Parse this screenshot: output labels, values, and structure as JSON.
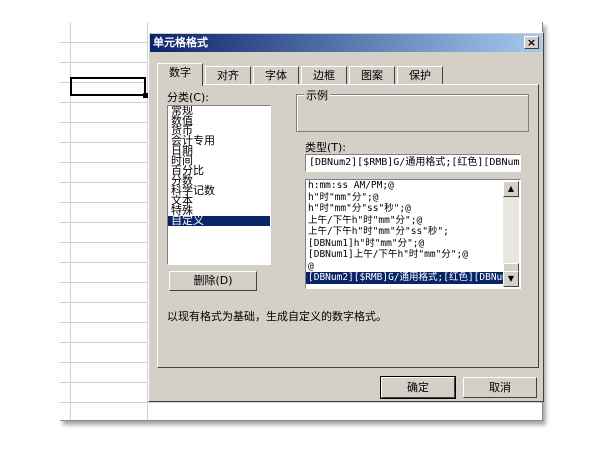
{
  "dialog": {
    "title": "单元格格式",
    "close_glyph": "×"
  },
  "tabs": [
    {
      "label": "数字",
      "active": true
    },
    {
      "label": "对齐",
      "active": false
    },
    {
      "label": "字体",
      "active": false
    },
    {
      "label": "边框",
      "active": false
    },
    {
      "label": "图案",
      "active": false
    },
    {
      "label": "保护",
      "active": false
    }
  ],
  "category": {
    "label": "分类(C):",
    "items": [
      "常规",
      "数值",
      "货币",
      "会计专用",
      "日期",
      "时间",
      "百分比",
      "分数",
      "科学记数",
      "文本",
      "特殊",
      "自定义"
    ],
    "selected": "自定义"
  },
  "delete_button": "删除(D)",
  "sample": {
    "label": "示例"
  },
  "type": {
    "label": "类型(T):",
    "value": "[DBNum2][$RMB]G/通用格式;[红色][DBNum2]",
    "options": [
      "h:mm:ss AM/PM;@",
      "h\"时\"mm\"分\";@",
      "h\"时\"mm\"分\"ss\"秒\";@",
      "上午/下午h\"时\"mm\"分\";@",
      "上午/下午h\"时\"mm\"分\"ss\"秒\";",
      "[DBNum1]h\"时\"mm\"分\";@",
      "[DBNum1]上午/下午h\"时\"mm\"分\";@",
      "@",
      "[DBNum2][$RMB]G/通用格式;[红色][DBNum2]"
    ],
    "selected": "[DBNum2][$RMB]G/通用格式;[红色][DBNum2]"
  },
  "description": "以现有格式为基础，生成自定义的数字格式。",
  "buttons": {
    "ok": "确定",
    "cancel": "取消"
  },
  "icons": {
    "scroll_up": "▲",
    "scroll_down": "▼"
  },
  "colors": {
    "title_bar": "#0a246a",
    "dialog_face": "#d4d0c8",
    "selection": "#0a246a"
  }
}
